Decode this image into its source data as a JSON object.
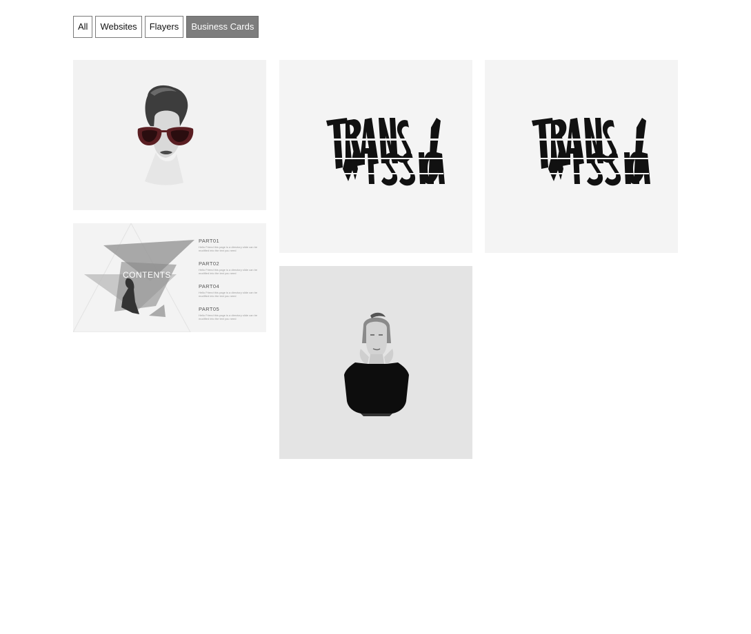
{
  "filters": {
    "items": [
      {
        "label": "All",
        "active": false
      },
      {
        "label": "Websites",
        "active": false
      },
      {
        "label": "Flayers",
        "active": false
      },
      {
        "label": "Business Cards",
        "active": true
      }
    ]
  },
  "portfolio": {
    "contents_slide": {
      "heading": "CONTENTS",
      "parts": [
        {
          "title": "PART01",
          "body": "Hello Friend this page is a directory slide can be modified into the text you need"
        },
        {
          "title": "PART02",
          "body": "Hello Friend this page is a directory slide can be modified into the text you need"
        },
        {
          "title": "PART04",
          "body": "Hello Friend this page is a directory slide can be modified into the text you need"
        },
        {
          "title": "PART05",
          "body": "Hello Friend this page is a directory slide can be modified into the text you need"
        }
      ]
    }
  },
  "colors": {
    "active_filter_bg": "#7d7d7d",
    "tile_bg": "#f4f4f4",
    "dark_tile_bg": "#e4e4e4"
  }
}
